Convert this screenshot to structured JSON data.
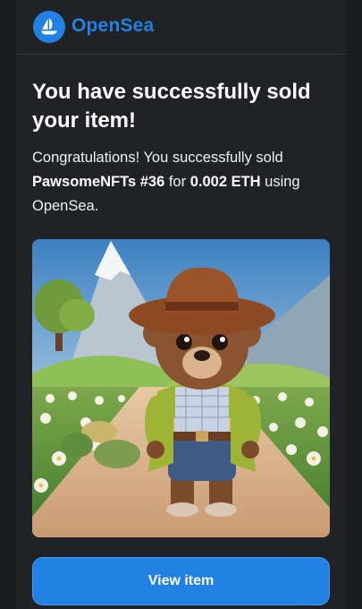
{
  "header": {
    "brand": "OpenSea",
    "logo_icon": "opensea-sailboat-icon",
    "brand_color": "#2081e2"
  },
  "message": {
    "headline": "You have successfully sold your item!",
    "intro": "Congratulations! You successfully sold ",
    "item_name": "PawsomeNFTs #36",
    "for_text": " for ",
    "price": "0.002 ETH",
    "outro": " using OpenSea."
  },
  "nft_image": {
    "description_icon": "bear-cowboy-nft-image"
  },
  "actions": {
    "view_item_label": "View item"
  }
}
